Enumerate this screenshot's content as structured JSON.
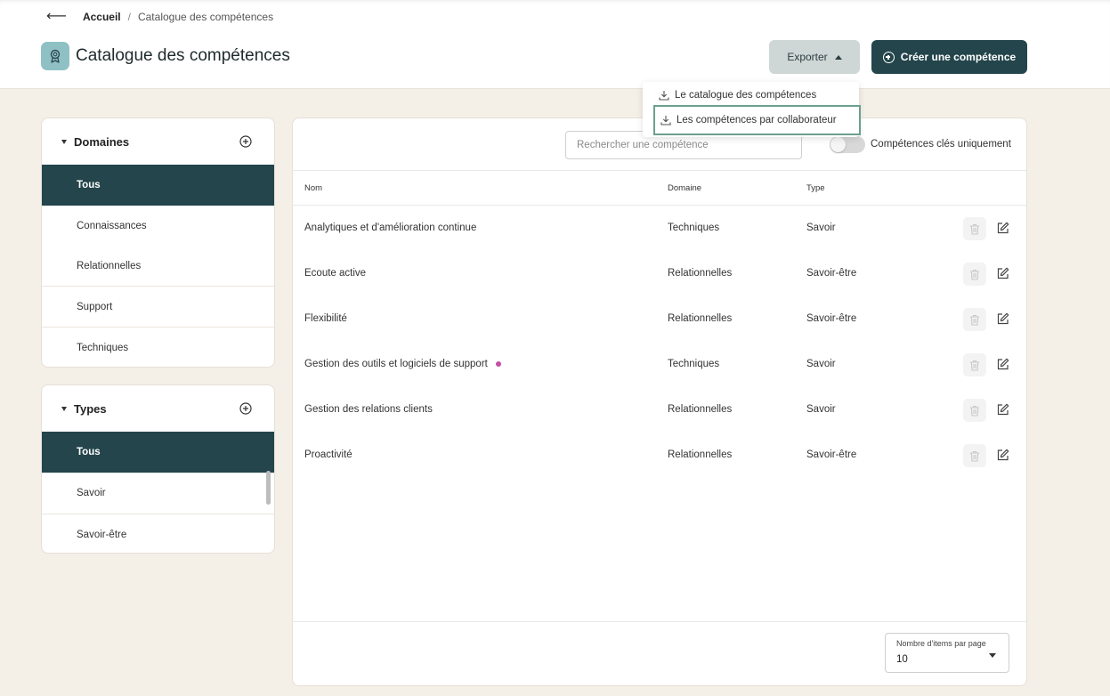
{
  "breadcrumb": {
    "home": "Accueil",
    "separator": "/",
    "current": "Catalogue des compétences"
  },
  "header": {
    "title": "Catalogue des compétences",
    "export_label": "Exporter",
    "create_label": "Créer une compétence"
  },
  "export_menu": {
    "items": [
      {
        "label": "Le catalogue des compétences"
      },
      {
        "label": "Les compétences par collaborateur"
      }
    ]
  },
  "domains": {
    "title": "Domaines",
    "items": [
      {
        "label": "Tous",
        "active": true
      },
      {
        "label": "Connaissances"
      },
      {
        "label": "Relationnelles"
      },
      {
        "label": "Support"
      },
      {
        "label": "Techniques"
      }
    ]
  },
  "types": {
    "title": "Types",
    "items": [
      {
        "label": "Tous",
        "active": true
      },
      {
        "label": "Savoir"
      },
      {
        "label": "Savoir-être"
      }
    ]
  },
  "search": {
    "placeholder": "Rechercher une compétence"
  },
  "toggle": {
    "label": "Compétences clés uniquement",
    "on": false
  },
  "table": {
    "columns": [
      "Nom",
      "Domaine",
      "Type"
    ],
    "rows": [
      {
        "name": "Analytiques et d'amélioration continue",
        "domain": "Techniques",
        "type": "Savoir"
      },
      {
        "name": "Ecoute active",
        "domain": "Relationnelles",
        "type": "Savoir-être"
      },
      {
        "name": "Flexibilité",
        "domain": "Relationnelles",
        "type": "Savoir-être"
      },
      {
        "name": "Gestion des outils et logiciels de support",
        "domain": "Techniques",
        "type": "Savoir",
        "marker": true
      },
      {
        "name": "Gestion des relations clients",
        "domain": "Relationnelles",
        "type": "Savoir"
      },
      {
        "name": "Proactivité",
        "domain": "Relationnelles",
        "type": "Savoir-être"
      }
    ]
  },
  "pagination": {
    "label": "Nombre d'items par page",
    "value": "10"
  },
  "colors": {
    "primary": "#23454b",
    "background": "#f4efe7",
    "marker": "#c44fa0",
    "highlight": "#6c9f8e"
  }
}
